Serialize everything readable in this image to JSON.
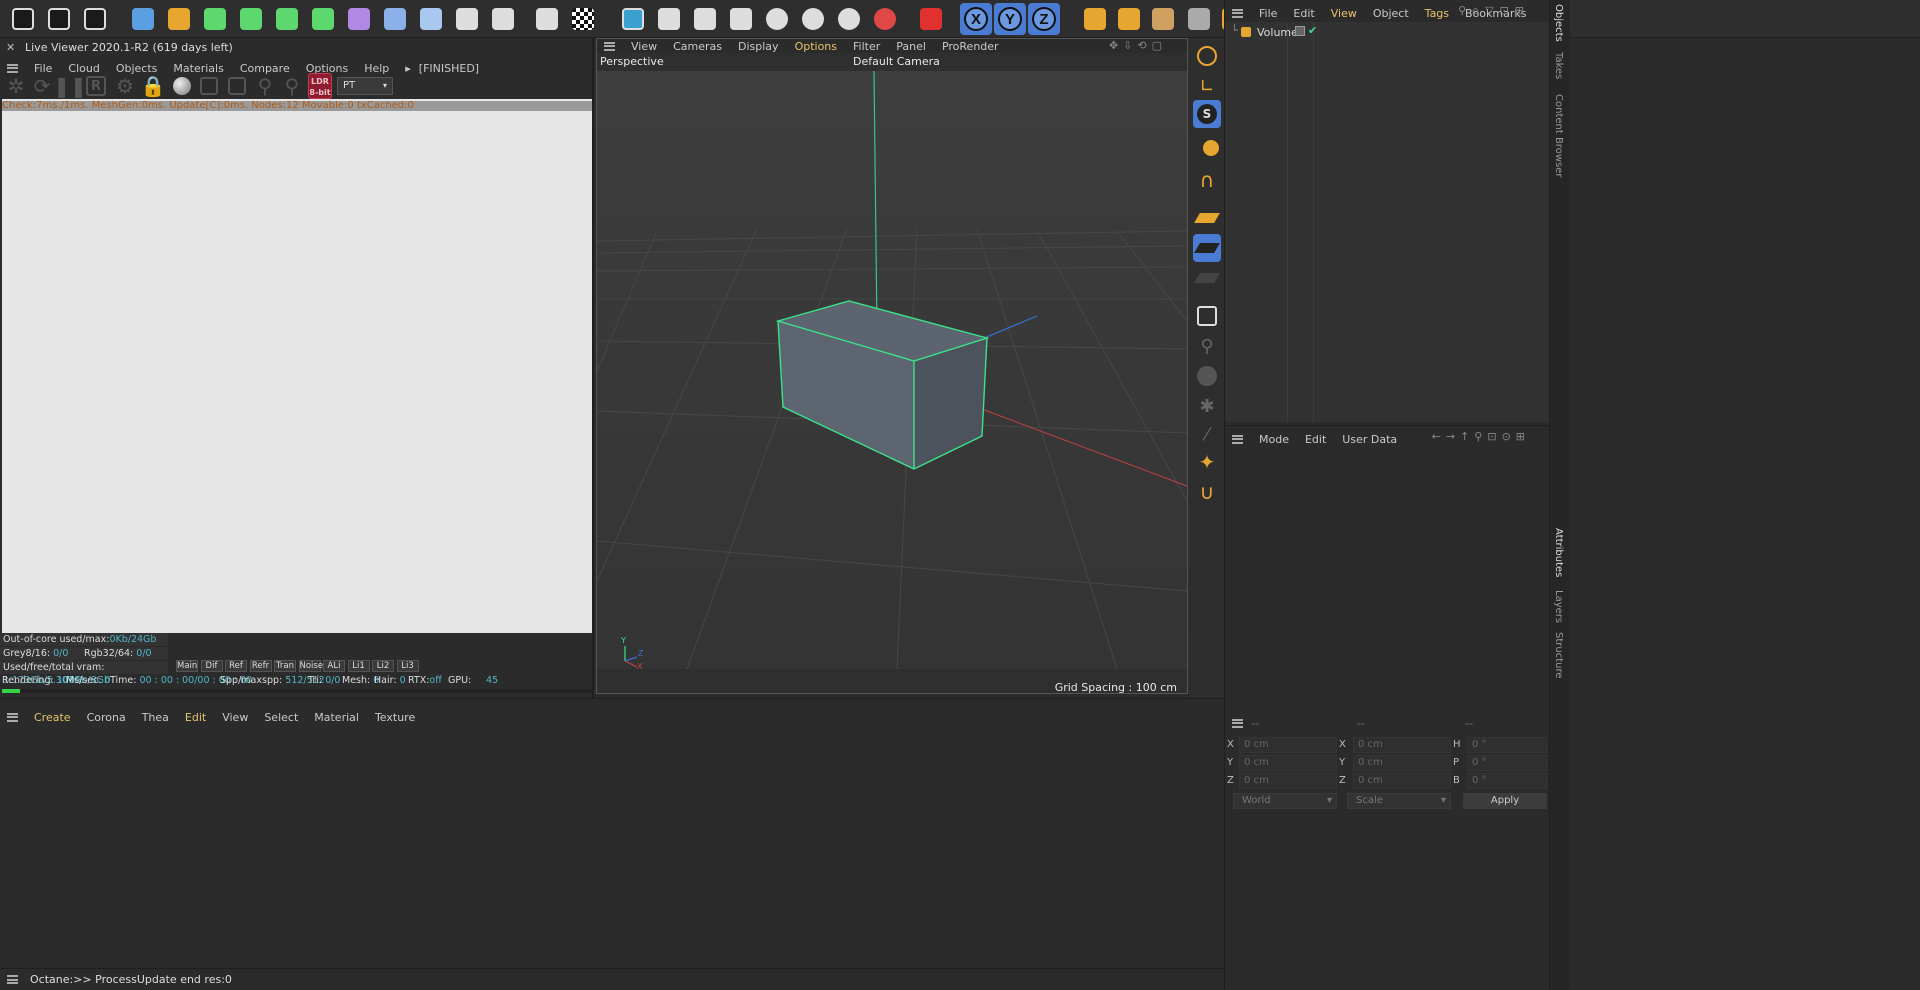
{
  "toolbar": {
    "buttons": [
      {
        "name": "clapper-icon",
        "color": "#1a1a1a"
      },
      {
        "name": "render-view-icon",
        "color": "#1a1a1a"
      },
      {
        "name": "render-settings-icon",
        "color": "#1a1a1a"
      },
      {
        "name": "cube-icon",
        "color": "#5aa0e0"
      },
      {
        "name": "pen-icon",
        "color": "#e6a630"
      },
      {
        "name": "spline-cube-icon",
        "color": "#5cd86e"
      },
      {
        "name": "cube-green-icon",
        "color": "#5cd86e"
      },
      {
        "name": "gear-cube-icon",
        "color": "#5cd86e"
      },
      {
        "name": "array-cube-icon",
        "color": "#5cd86e"
      },
      {
        "name": "deformer-icon",
        "color": "#b288e6"
      },
      {
        "name": "capsule-icon",
        "color": "#8ab0e8"
      },
      {
        "name": "floor-icon",
        "color": "#a9c8ef"
      },
      {
        "name": "camera-icon",
        "color": "#dddddd"
      },
      {
        "name": "light-icon",
        "color": "#dddddd"
      },
      {
        "name": "grid-icon",
        "color": "#dddddd"
      },
      {
        "name": "checker-icon",
        "color": "#ffffff"
      },
      {
        "name": "octane-clapper-icon",
        "color": "#3aa0d0"
      },
      {
        "name": "octane-settings-icon",
        "color": "#dddddd"
      },
      {
        "name": "half-circle-icon",
        "color": "#dddddd"
      },
      {
        "name": "shuffle-icon",
        "color": "#dddddd"
      },
      {
        "name": "sphere-bw-icon",
        "color": "#dddddd"
      },
      {
        "name": "mix-icon",
        "color": "#dddddd"
      },
      {
        "name": "blend-icon",
        "color": "#dddddd"
      },
      {
        "name": "help-badge-icon",
        "color": "#e04848"
      },
      {
        "name": "snapshot-icon",
        "color": "#e03030"
      }
    ],
    "xyz": [
      "X",
      "Y",
      "Z"
    ],
    "right_icons": [
      "cube-orange-icon",
      "checker-cube-icon",
      "cube-outline-icon",
      "cube-gray-icon",
      "cube-solid-icon",
      "corner-icon",
      "sphere-gray-icon",
      "plus-orange-icon",
      "octane-logo-icon"
    ]
  },
  "live_viewer": {
    "title": "Live Viewer 2020.1-R2 (619 days left)",
    "menu": [
      "File",
      "Cloud",
      "Objects",
      "Materials",
      "Compare",
      "Options",
      "Help"
    ],
    "finished": "[FINISHED]",
    "mode": "PT",
    "ldr_line1": "LDR",
    "ldr_line2": "8-bit",
    "status_line": "Check:7ms./1ms. MeshGen:0ms. Update[C]:0ms. Nodes:12 Movable:0 txCached:0",
    "out_of_core_label": "Out-of-core used/max:",
    "out_of_core_value": "0Kb/24Gb",
    "grey_label": "Grey8/16:",
    "grey_value": "0/0",
    "rgb_label": "Rgb32/64:",
    "rgb_value": "0/0",
    "vram_label": "Used/free/total vram:",
    "vram_value": "1.173Gb/5.307Gb/8Gb",
    "channels": [
      "Main",
      "Dif",
      "Ref",
      "Refr",
      "Tran",
      "Noise",
      "ALi",
      "Li1",
      "Li2",
      "Li3"
    ],
    "render_line": {
      "rendering_label": "Rendering:",
      "rendering_value": "100%",
      "ms_label": "Ms/sec:",
      "ms_value": "0",
      "time_label": "Time:",
      "time_value": "00 : 00 : 00/00 : 00 : 00",
      "spp_label": "Spp/maxspp:",
      "spp_value": "512/512",
      "tri_label": "Tri:",
      "tri_value": "0/0",
      "mesh_label": "Mesh:",
      "mesh_value": "0",
      "hair_label": "Hair:",
      "hair_value": "0",
      "rtx_label": "RTX:",
      "rtx_value": "off",
      "gpu_label": "GPU:",
      "gpu_value": "45"
    },
    "progress": 0.03
  },
  "viewport": {
    "menu": [
      "View",
      "Cameras",
      "Display",
      "Options",
      "Filter",
      "Panel",
      "ProRender"
    ],
    "active_menu": "Options",
    "perspective": "Perspective",
    "camera": "Default Camera",
    "grid_spacing": "Grid Spacing : 100 cm",
    "axis_x": "X",
    "axis_y": "Y",
    "axis_z": "Z"
  },
  "objects": {
    "menu": [
      "File",
      "Edit",
      "View",
      "Object",
      "Tags",
      "Bookmarks"
    ],
    "highlight": [
      "View",
      "Tags"
    ],
    "items": [
      {
        "name": "Volume"
      }
    ]
  },
  "attributes": {
    "menu": [
      "Mode",
      "Edit",
      "User Data"
    ]
  },
  "coords": {
    "headers": [
      "--",
      "--",
      "--"
    ],
    "rows": [
      {
        "a": "X",
        "av": "0 cm",
        "b": "X",
        "bv": "0 cm",
        "c": "H",
        "cv": "0 °"
      },
      {
        "a": "Y",
        "av": "0 cm",
        "b": "Y",
        "bv": "0 cm",
        "c": "P",
        "cv": "0 °"
      },
      {
        "a": "Z",
        "av": "0 cm",
        "b": "Z",
        "bv": "0 cm",
        "c": "B",
        "cv": "0 °"
      }
    ],
    "world": "World",
    "scale": "Scale",
    "apply": "Apply"
  },
  "material_manager": {
    "menu": [
      "Create",
      "Corona",
      "Thea",
      "Edit",
      "View",
      "Select",
      "Material",
      "Texture"
    ],
    "highlight": [
      "Create",
      "Edit"
    ]
  },
  "console": {
    "text": "Octane:>> ProcessUpdate end res:0"
  },
  "side_tabs": {
    "top": [
      "Objects",
      "Takes",
      "Content Browser"
    ],
    "bottom": [
      "Attributes",
      "Layers",
      "Structure"
    ]
  }
}
